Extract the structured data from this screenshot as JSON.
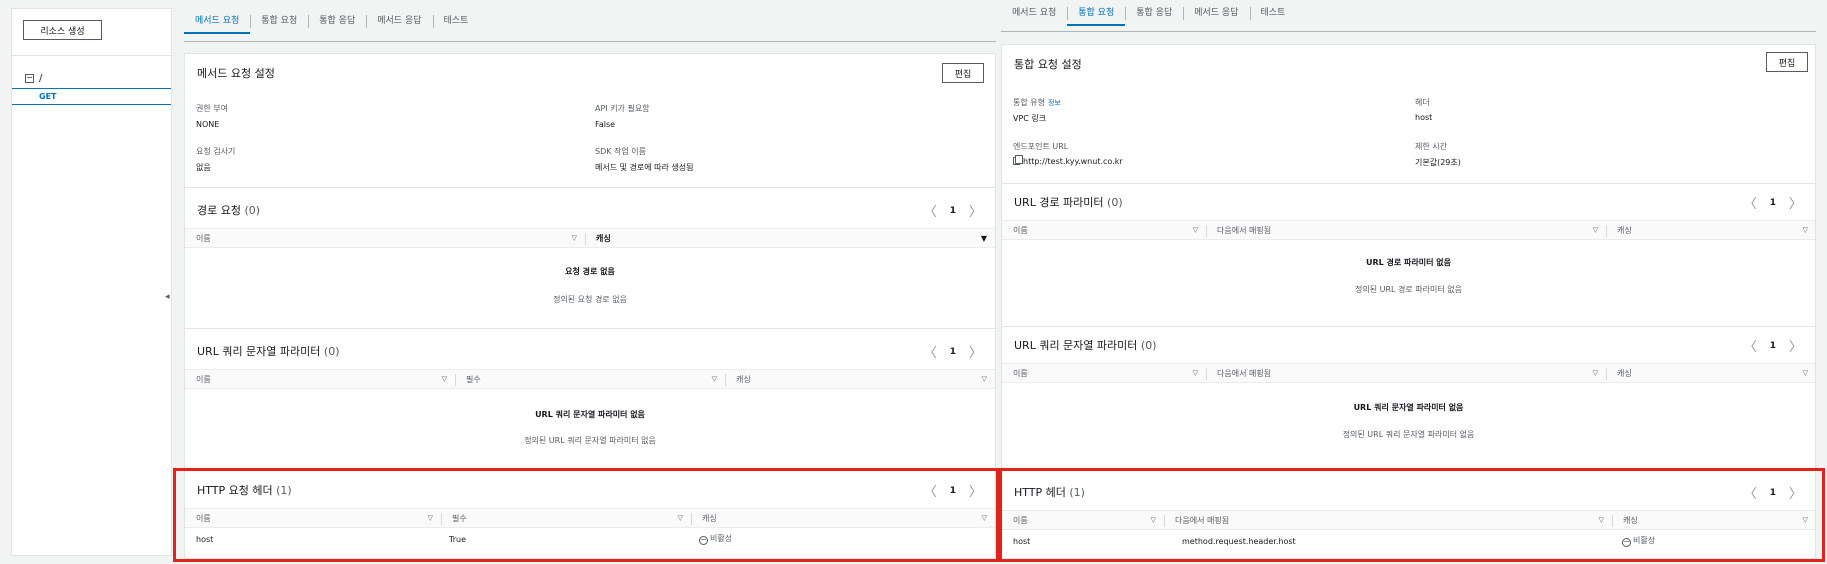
{
  "sidebar": {
    "create_resource_label": "리소스 생성",
    "collapse_symbol": "−",
    "root_path": "/",
    "selected_method": "GET",
    "resize_symbol": "◂"
  },
  "left": {
    "tabs": [
      {
        "label": "메서드 요청",
        "active": true
      },
      {
        "label": "통합 요청"
      },
      {
        "label": "통합 응답"
      },
      {
        "label": "메서드 응답"
      },
      {
        "label": "테스트"
      }
    ],
    "settings": {
      "title": "메서드 요청 설정",
      "edit_label": "편집",
      "fields": [
        {
          "label": "권한 부여",
          "value": "NONE"
        },
        {
          "label": "API 키가 필요함",
          "value": "False"
        },
        {
          "label": "요청 검사기",
          "value": "없음"
        },
        {
          "label": "SDK 작업 이름",
          "value": "메서드 및 경로에 따라 생성됨"
        }
      ]
    },
    "path_params": {
      "title": "경로 요청",
      "count": "(0)",
      "page": "1",
      "columns": [
        "이름",
        "캐싱"
      ],
      "empty_title": "요청 경로 없음",
      "empty_sub": "정의된 요청 경로 없음"
    },
    "query_params": {
      "title": "URL 쿼리 문자열 파라미터",
      "count": "(0)",
      "page": "1",
      "columns": [
        "이름",
        "필수",
        "캐싱"
      ],
      "empty_title": "URL 쿼리 문자열 파라미터 없음",
      "empty_sub": "정의된 URL 쿼리 문자열 파라미터 없음"
    },
    "headers": {
      "title": "HTTP 요청 헤더",
      "count": "(1)",
      "page": "1",
      "columns": [
        "이름",
        "필수",
        "캐싱"
      ],
      "row": {
        "name": "host",
        "required": "True",
        "caching": "비활성"
      }
    }
  },
  "right": {
    "tabs": [
      {
        "label": "메서드 요청"
      },
      {
        "label": "통합 요청",
        "active": true
      },
      {
        "label": "통합 응답"
      },
      {
        "label": "메서드 응답"
      },
      {
        "label": "테스트"
      }
    ],
    "settings": {
      "title": "통합 요청 설정",
      "edit_label": "편집",
      "integration_type_label": "통합 유형",
      "info_label": "정보",
      "integration_type_value": "VPC 링크",
      "header_label": "헤더",
      "header_value": "host",
      "endpoint_label": "엔드포인트 URL",
      "endpoint_value": "http://test.kyy.wnut.co.kr",
      "timeout_label": "제한 시간",
      "timeout_value": "기본값(29초)"
    },
    "path_params": {
      "title": "URL 경로 파라미터",
      "count": "(0)",
      "page": "1",
      "columns": [
        "이름",
        "다음에서 매핑됨",
        "캐싱"
      ],
      "empty_title": "URL 경로 파라미터 없음",
      "empty_sub": "정의된 URL 경로 파라미터 없음"
    },
    "query_params": {
      "title": "URL 쿼리 문자열 파라미터",
      "count": "(0)",
      "page": "1",
      "columns": [
        "이름",
        "다음에서 매핑됨",
        "캐싱"
      ],
      "empty_title": "URL 쿼리 문자열 파라미터 없음",
      "empty_sub": "정의된 URL 쿼리 문자열 파라미터 없음"
    },
    "headers": {
      "title": "HTTP 헤더",
      "count": "(1)",
      "page": "1",
      "columns": [
        "이름",
        "다음에서 매핑됨",
        "캐싱"
      ],
      "row": {
        "name": "host",
        "mapped_from": "method.request.header.host",
        "caching": "비활성"
      }
    }
  },
  "pager": {
    "prev": "〈",
    "next": "〉"
  },
  "icons": {
    "sort": "▽",
    "sort_filled": "▼",
    "minus": "−"
  },
  "colors": {
    "accent": "#0073bb",
    "highlight": "#e3221c"
  }
}
